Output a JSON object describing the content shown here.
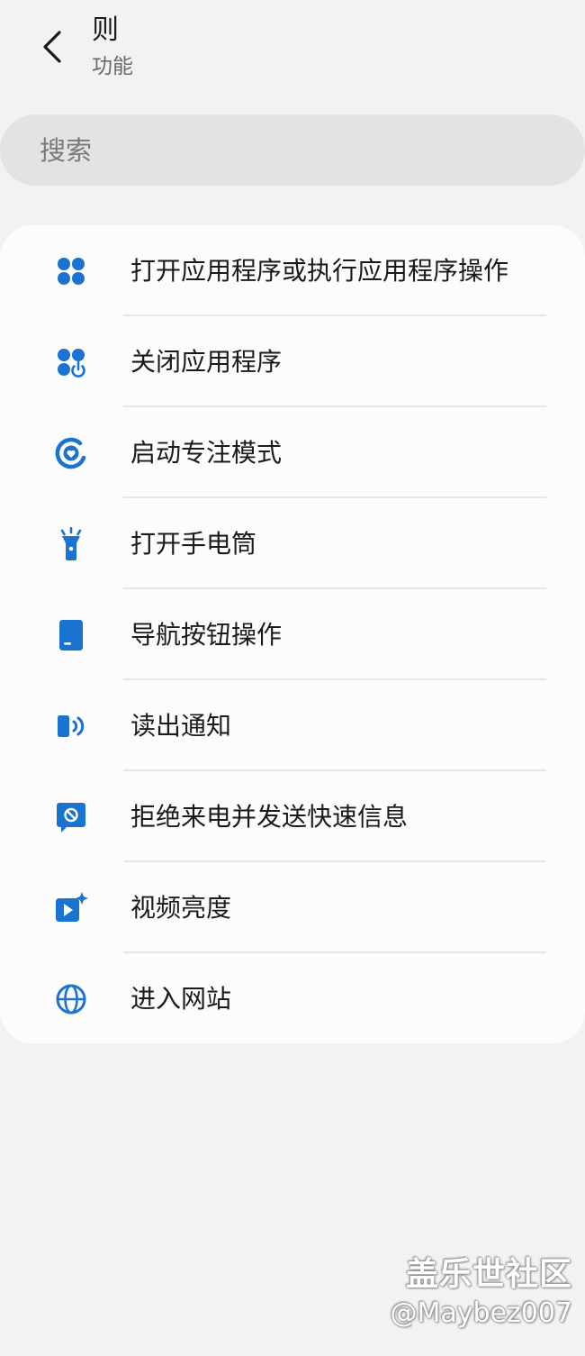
{
  "header": {
    "title": "则",
    "subtitle": "功能"
  },
  "search": {
    "placeholder": "搜索"
  },
  "accent_color": "#1a73cf",
  "actions": [
    {
      "label": "打开应用程序或执行应用程序操作",
      "icon": "apps-icon"
    },
    {
      "label": "关闭应用程序",
      "icon": "close-apps-icon"
    },
    {
      "label": "启动专注模式",
      "icon": "focus-mode-icon"
    },
    {
      "label": "打开手电筒",
      "icon": "flashlight-icon"
    },
    {
      "label": "导航按钮操作",
      "icon": "navigation-bar-icon"
    },
    {
      "label": "读出通知",
      "icon": "read-aloud-icon"
    },
    {
      "label": "拒绝来电并发送快速信息",
      "icon": "reject-call-message-icon"
    },
    {
      "label": "视频亮度",
      "icon": "video-brightness-icon"
    },
    {
      "label": "进入网站",
      "icon": "globe-icon"
    }
  ],
  "watermark": {
    "brand": "盖乐世社区",
    "user": "@Maybez007"
  }
}
